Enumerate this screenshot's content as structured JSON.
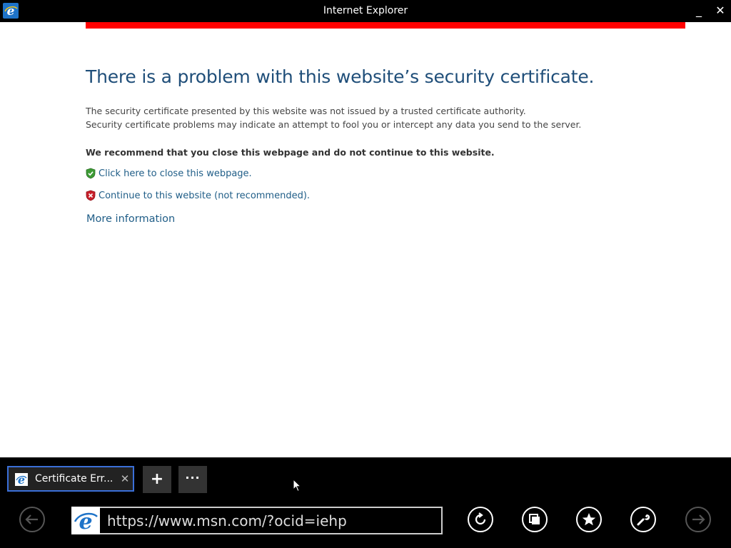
{
  "window": {
    "title": "Internet Explorer",
    "minimize": "_",
    "close": "✕"
  },
  "page": {
    "heading": "There is a problem with this website’s security certificate.",
    "desc_line1": "The security certificate presented by this website was not issued by a trusted certificate authority.",
    "desc_line2": "Security certificate problems may indicate an attempt to fool you or intercept any data you send to the server.",
    "recommendation": "We recommend that you close this webpage and do not continue to this website.",
    "close_link": "Click here to close this webpage.",
    "continue_link": "Continue to this website (not recommended).",
    "more_info": "More information"
  },
  "tabbar": {
    "tab_title": "Certificate Err...",
    "tab_close": "✕",
    "new_tab": "+",
    "more": "···"
  },
  "navbar": {
    "url": "https://www.msn.com/?ocid=iehp"
  },
  "icons": {
    "app": "ie-logo-icon",
    "back": "back-arrow-icon",
    "forward": "forward-arrow-icon",
    "refresh": "refresh-icon",
    "tabs": "tabs-icon",
    "favorites": "star-icon",
    "tools": "wrench-icon",
    "shield_ok": "green-shield-icon",
    "shield_bad": "red-shield-icon"
  },
  "colors": {
    "accent": "#1f5d87",
    "alert_bar": "#ff0000",
    "tab_border": "#3a6fd8"
  }
}
